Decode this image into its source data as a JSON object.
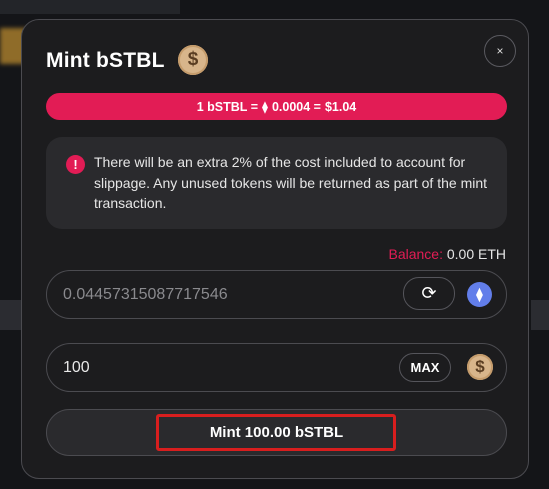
{
  "modal": {
    "title": "Mint bSTBL",
    "title_coin_symbol": "$",
    "close_symbol": "×",
    "rate": {
      "prefix": "1 bSTBL =",
      "eth_symbol": "⧫",
      "eth_value": "0.0004 =",
      "usd_value": "$1.04"
    },
    "notice": {
      "icon_symbol": "!",
      "text": "There will be an extra 2% of the cost included to account for slippage. Any unused tokens will be returned as part of the mint transaction."
    },
    "balance": {
      "label": "Balance:",
      "value": "0.00 ETH"
    },
    "eth_field": {
      "value": "0.04457315087717546",
      "swap_symbol": "⟳",
      "token_icon": "eth-icon",
      "token_symbol": "⧫"
    },
    "amount_field": {
      "value": "100",
      "max_label": "MAX",
      "token_icon": "bstbl-coin-icon",
      "token_symbol": "$"
    },
    "mint_button_label": "Mint 100.00 bSTBL"
  },
  "colors": {
    "accent": "#e21c55",
    "background": "#1c1c1e",
    "panel": "#2a2a2d",
    "coin": "#d8b58b",
    "eth": "#627eea",
    "highlight": "#d81e1e"
  }
}
